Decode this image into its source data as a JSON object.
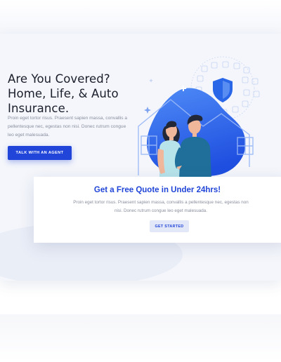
{
  "hero": {
    "title_lines": [
      "Are You Covered?",
      "Home, Life, & Auto",
      "Insurance."
    ],
    "body": "Proin eget tortor risus. Praesent sapien massa, convallis a pellentesque nec, egestas non nisi. Donec rutrum congue leo eget malesuada.",
    "cta_label": "TALK WITH AN AGENT"
  },
  "quote": {
    "title": "Get a Free Quote in Under 24hrs!",
    "body": "Proin eget tortor risus. Praesent sapien massa, convallis a pellentesque nec, egestas non nisi. Donec rutrum congue leo eget malesuada.",
    "button_label": "GET STARTED"
  },
  "colors": {
    "accent": "#2145d8",
    "heading": "#1b1e2b",
    "body_text": "#8a8f9e",
    "page_bg": "#f4f6fb"
  },
  "illustration": {
    "icon": "family-home-insurance-illustration",
    "shield_icon": "shield-icon"
  }
}
